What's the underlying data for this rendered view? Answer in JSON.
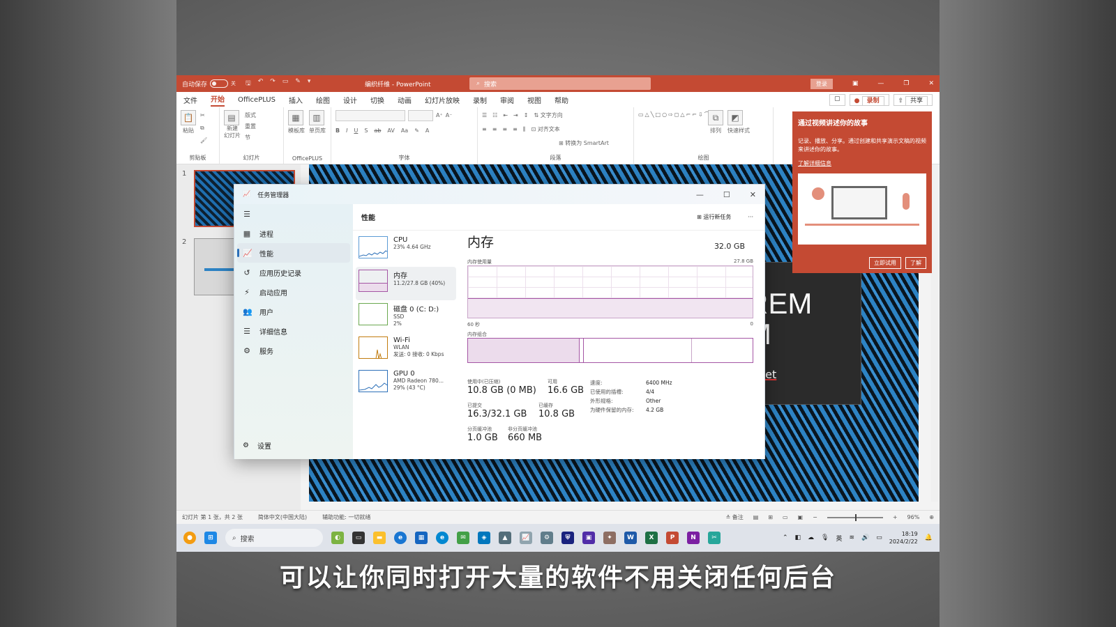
{
  "ppt": {
    "autosave_label": "自动保存",
    "autosave_state": "关",
    "doc_name": "编织纤维 - PowerPoint",
    "search_placeholder": "搜索",
    "login_label": "登录",
    "menu": [
      "文件",
      "开始",
      "OfficePLUS",
      "插入",
      "绘图",
      "设计",
      "切换",
      "动画",
      "幻灯片放映",
      "录制",
      "审阅",
      "视图",
      "帮助"
    ],
    "active_menu": "开始",
    "record_label": "录制",
    "share_label": "共享",
    "ribbon_groups": [
      "剪贴板",
      "幻灯片",
      "OfficePLUS",
      "字体",
      "段落",
      "绘图"
    ],
    "ribbon_paste": "粘贴",
    "ribbon_new_slide": "新建\n幻灯片",
    "ribbon_layout": "版式",
    "ribbon_reset": "重置",
    "ribbon_section": "节",
    "ribbon_template": "模板库",
    "ribbon_single_page": "单页库",
    "ribbon_text_dir": "文字方向",
    "ribbon_align_text": "对齐文本",
    "ribbon_smartart": "转换为 SmartArt",
    "ribbon_arrange": "排列",
    "ribbon_quick_style": "快速样式",
    "slide_numbers": [
      "1",
      "2"
    ],
    "slide_text": [
      "REM",
      "M",
      "net"
    ],
    "status": {
      "slide_info": "幻灯片 第 1 张，共 2 张",
      "language": "简体中文(中国大陆)",
      "accessibility": "辅助功能: 一切就绪",
      "notes": "备注",
      "zoom": "96%"
    }
  },
  "popup": {
    "title": "通过视频讲述你的故事",
    "body": "记录、播放、分享。通过创建和共享演示文稿的视频来讲述你的故事。",
    "link": "了解详细信息",
    "try_now": "立即试用",
    "learn": "了解"
  },
  "taskbar": {
    "search": "搜索",
    "ime": "英",
    "time": "18:19",
    "date": "2024/2/22"
  },
  "taskmgr": {
    "title": "任务管理器",
    "nav": [
      "进程",
      "性能",
      "应用历史记录",
      "启动应用",
      "用户",
      "详细信息",
      "服务"
    ],
    "selected_nav": "性能",
    "settings": "设置",
    "header": "性能",
    "run_task": "运行新任务",
    "more": "···",
    "perf_items": [
      {
        "name": "CPU",
        "sub1": "23% 4.64 GHz",
        "sub2": ""
      },
      {
        "name": "内存",
        "sub1": "11.2/27.8 GB (40%)",
        "sub2": ""
      },
      {
        "name": "磁盘 0 (C: D:)",
        "sub1": "SSD",
        "sub2": "2%"
      },
      {
        "name": "Wi-Fi",
        "sub1": "WLAN",
        "sub2": "发送: 0 接收: 0 Kbps"
      },
      {
        "name": "GPU 0",
        "sub1": "AMD Radeon 780...",
        "sub2": "29% (43 °C)"
      }
    ],
    "memory": {
      "title": "内存",
      "total": "32.0 GB",
      "usage_label": "内存使用量",
      "usage_max": "27.8 GB",
      "axis_left": "60 秒",
      "axis_right": "0",
      "composition_label": "内存组合",
      "in_use_label": "使用中(已压缩)",
      "in_use_value": "10.8 GB (0 MB)",
      "available_label": "可用",
      "available_value": "16.6 GB",
      "committed_label": "已提交",
      "committed_value": "16.3/32.1 GB",
      "cached_label": "已缓存",
      "cached_value": "10.8 GB",
      "paged_label": "分页缓冲池",
      "paged_value": "1.0 GB",
      "nonpaged_label": "非分页缓冲池",
      "nonpaged_value": "660 MB",
      "speed_label": "速度:",
      "speed_value": "6400 MHz",
      "slots_label": "已使用的插槽:",
      "slots_value": "4/4",
      "form_label": "外形规格:",
      "form_value": "Other",
      "reserved_label": "为硬件保留的内存:",
      "reserved_value": "4.2 GB"
    }
  },
  "subtitle": "可以让你同时打开大量的软件不用关闭任何后台",
  "colors": {
    "ppt_accent": "#c44a33",
    "memory_accent": "#a455a4",
    "slide_blue": "#2d83c4"
  }
}
